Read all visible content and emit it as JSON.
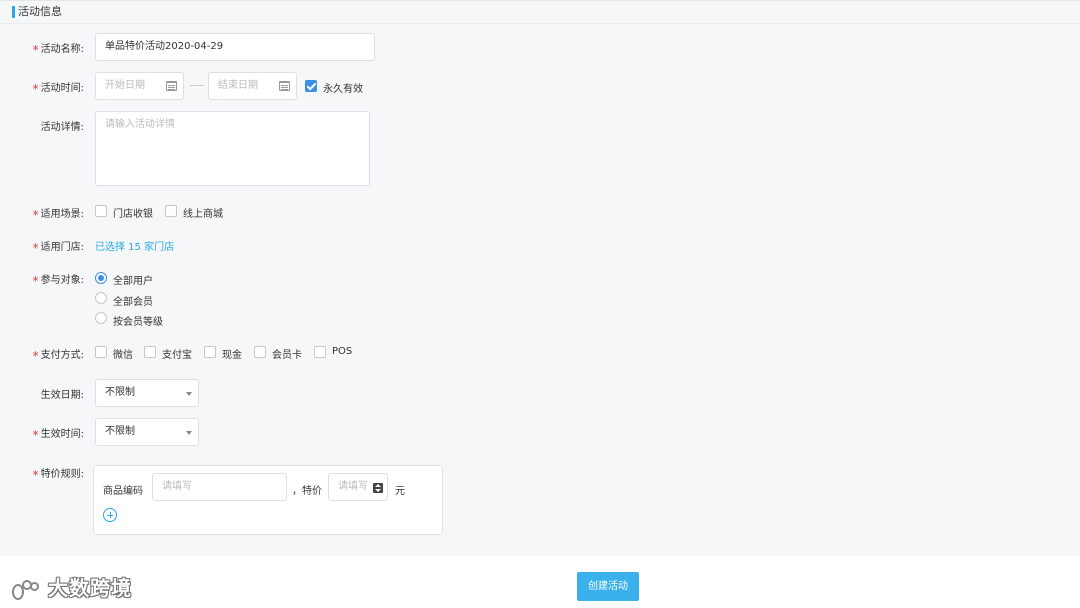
{
  "section": {
    "title": "活动信息"
  },
  "form": {
    "name": {
      "label": "活动名称:",
      "value": "单品特价活动2020-04-29"
    },
    "time": {
      "label": "活动时间:",
      "start_placeholder": "开始日期",
      "end_placeholder": "结束日期",
      "forever_label": "永久有效",
      "forever_checked": true
    },
    "detail": {
      "label": "活动详情:",
      "placeholder": "请输入活动详情"
    },
    "scene": {
      "label": "适用场景:",
      "options": [
        "门店收银",
        "线上商城"
      ]
    },
    "stores": {
      "label": "适用门店:",
      "link": "已选择 15 家门店"
    },
    "target": {
      "label": "参与对象:",
      "options": [
        "全部用户",
        "全部会员",
        "按会员等级"
      ],
      "selected": "全部用户"
    },
    "payment": {
      "label": "支付方式:",
      "options": [
        "微信",
        "支付宝",
        "现金",
        "会员卡",
        "POS"
      ]
    },
    "effective_date": {
      "label": "生效日期:",
      "value": "不限制"
    },
    "effective_time": {
      "label": "生效时间:",
      "value": "不限制"
    },
    "rule": {
      "label": "特价规则:",
      "code_label": "商品编码",
      "code_placeholder": "请填写",
      "price_label": "，特价",
      "price_placeholder": "请填写",
      "unit": "元"
    }
  },
  "actions": {
    "create": "创建活动"
  },
  "watermark": {
    "text": "大数跨境"
  },
  "colors": {
    "accent": "#29a8e8",
    "primary_button": "#3ab0ec",
    "required": "#e4393c",
    "checked": "#3a8ee6"
  }
}
